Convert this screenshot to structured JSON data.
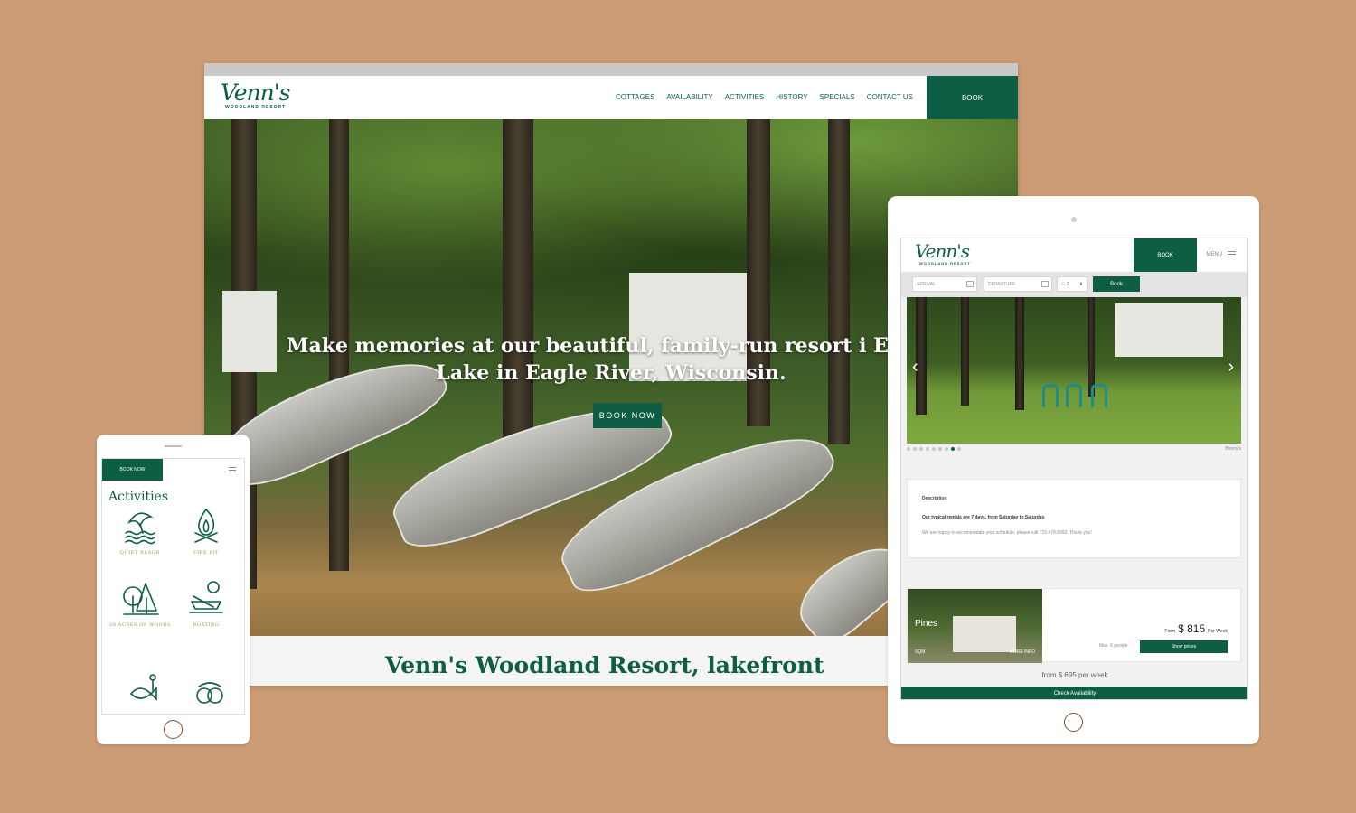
{
  "desktop": {
    "logo": {
      "script": "Venn's",
      "sub": "WOODLAND RESORT"
    },
    "nav": [
      "COTTAGES",
      "AVAILABILITY",
      "ACTIVITIES",
      "HISTORY",
      "SPECIALS",
      "CONTACT US"
    ],
    "book_label": "BOOK",
    "hero_heading": "Make memories at our beautiful, family-run resort i Eagle Lake in Eagle River, Wisconsin.",
    "hero_button": "BOOK NOW",
    "section_heading": "Venn's Woodland Resort, lakefront"
  },
  "tablet": {
    "logo": {
      "script": "Venn's",
      "sub": "WOODLAND RESORT"
    },
    "book_label": "BOOK",
    "menu_label": "MENU",
    "arrival_placeholder": "ARRIVAL",
    "departure_placeholder": "DEPARTURE",
    "guests_value": "2",
    "search_button": "Book",
    "slider_caption": "Bunny's",
    "slider_dots": 9,
    "slider_active_dot": 8,
    "description": {
      "title": "Description",
      "line1": "Our typical rentals are 7 days, from Saturday to Saturday.",
      "line2": "We are happy to accommodate your schedule, please call 715.479.8993. Thank you!"
    },
    "cottage": {
      "name": "Pines",
      "size_unit": "SQM",
      "more_info": "MORE INFO",
      "from_label": "From",
      "price": "$ 815",
      "per_label": "Per Week",
      "capacity": "Max. 6 people",
      "button": "Show prices"
    },
    "from_text": "from  $ 695 per week",
    "check_button": "Check Availability"
  },
  "phone": {
    "book_label": "BOOK NOW",
    "title": "Activities",
    "activities": [
      {
        "label": "QUIET BEACH",
        "icon": "beach-umbrella-icon"
      },
      {
        "label": "FIRE PIT",
        "icon": "campfire-icon"
      },
      {
        "label": "20 ACRES OF WOODS",
        "icon": "trees-icon"
      },
      {
        "label": "BOATING",
        "icon": "rowboat-icon"
      }
    ]
  },
  "colors": {
    "brand_green": "#0e5e46",
    "background": "#cc9c74",
    "accent_gold": "#b08a4e"
  }
}
